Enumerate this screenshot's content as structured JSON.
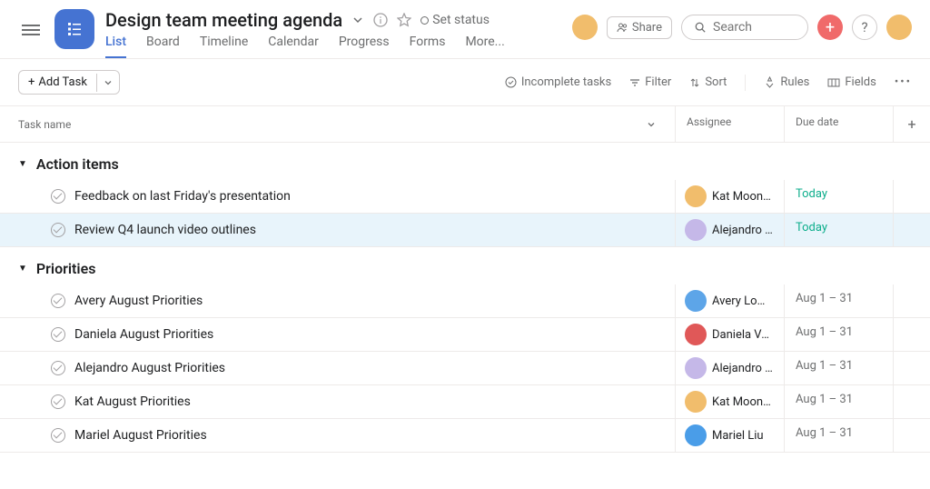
{
  "header": {
    "title": "Design team meeting agenda",
    "share_label": "Share",
    "search_placeholder": "Search",
    "status_label": "Set status",
    "avatar_color": "#f1bd6c"
  },
  "tabs": [
    "List",
    "Board",
    "Timeline",
    "Calendar",
    "Progress",
    "Forms",
    "More..."
  ],
  "active_tab": 0,
  "toolbar": {
    "add_task": "Add Task",
    "incomplete": "Incomplete tasks",
    "filter": "Filter",
    "sort": "Sort",
    "rules": "Rules",
    "fields": "Fields"
  },
  "columns": {
    "task": "Task name",
    "assignee": "Assignee",
    "due": "Due date"
  },
  "sections": [
    {
      "name": "Action items",
      "tasks": [
        {
          "title": "Feedback on last Friday's presentation",
          "assignee": "Kat Mooney",
          "avatar": "#f1bd6c",
          "due": "Today",
          "today": true,
          "hl": false
        },
        {
          "title": "Review Q4 launch video outlines",
          "assignee": "Alejandro Lu...",
          "avatar": "#c5b8e8",
          "due": "Today",
          "today": true,
          "hl": true
        }
      ]
    },
    {
      "name": "Priorities",
      "tasks": [
        {
          "title": "Avery August Priorities",
          "assignee": "Avery Lomax",
          "avatar": "#5da5e8",
          "due": "Aug 1 – 31",
          "today": false,
          "hl": false
        },
        {
          "title": "Daniela August Priorities",
          "assignee": "Daniela Varg...",
          "avatar": "#e05858",
          "due": "Aug 1 – 31",
          "today": false,
          "hl": false
        },
        {
          "title": "Alejandro August Priorities",
          "assignee": "Alejandro Lu...",
          "avatar": "#c5b8e8",
          "due": "Aug 1 – 31",
          "today": false,
          "hl": false
        },
        {
          "title": "Kat August Priorities",
          "assignee": "Kat Mooney",
          "avatar": "#f1bd6c",
          "due": "Aug 1 – 31",
          "today": false,
          "hl": false
        },
        {
          "title": "Mariel August Priorities",
          "assignee": "Mariel Liu",
          "avatar": "#4a9de8",
          "due": "Aug 1 – 31",
          "today": false,
          "hl": false
        }
      ]
    }
  ]
}
